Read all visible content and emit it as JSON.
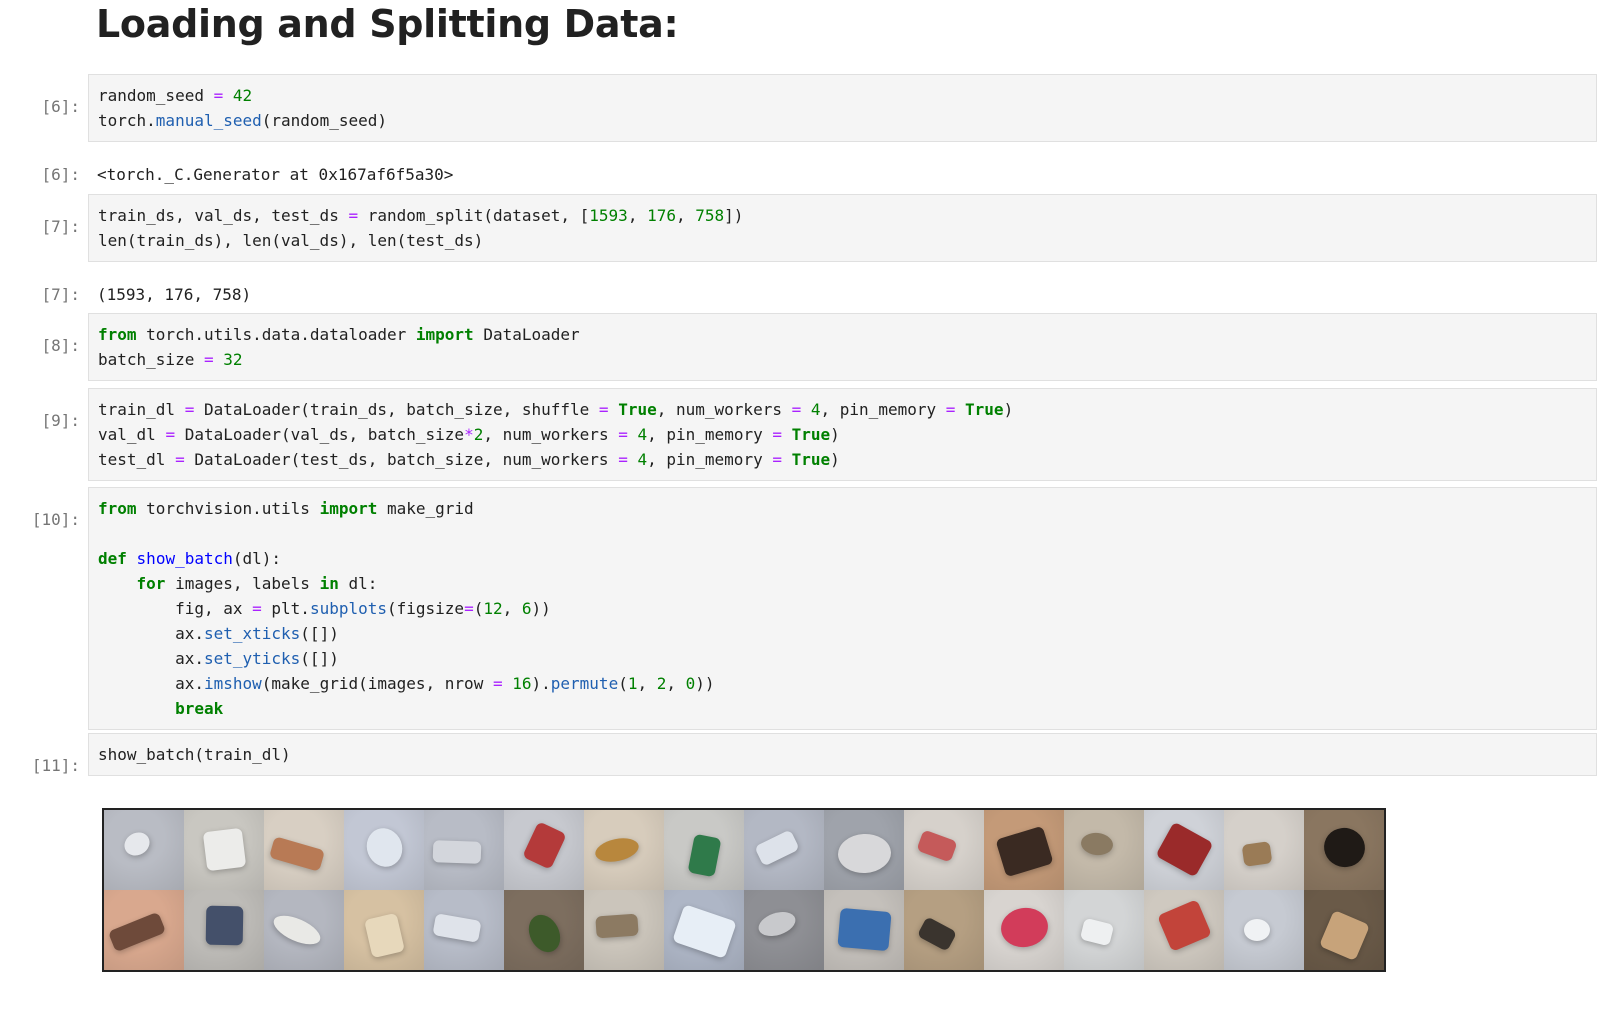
{
  "heading": "Loading and Splitting Data:",
  "cells": [
    {
      "in_prompt": "[6]:",
      "out_prompt": "[6]:",
      "output": "<torch._C.Generator at 0x167af6f5a30>"
    },
    {
      "in_prompt": "[7]:",
      "out_prompt": "[7]:",
      "output": "(1593, 176, 758)"
    },
    {
      "in_prompt": "[8]:"
    },
    {
      "in_prompt": "[9]:"
    },
    {
      "in_prompt": "[10]:"
    },
    {
      "in_prompt": "[11]:"
    }
  ],
  "code": {
    "c6": [
      "random_seed = 42",
      "torch.manual_seed(random_seed)"
    ],
    "c7": [
      "train_ds, val_ds, test_ds = random_split(dataset, [1593, 176, 758])",
      "len(train_ds), len(val_ds), len(test_ds)"
    ],
    "c8": [
      "from torch.utils.data.dataloader import DataLoader",
      "batch_size = 32"
    ],
    "c9": [
      "train_dl = DataLoader(train_ds, batch_size, shuffle = True, num_workers = 4, pin_memory = True)",
      "val_dl = DataLoader(val_ds, batch_size*2, num_workers = 4, pin_memory = True)",
      "test_dl = DataLoader(test_ds, batch_size, num_workers = 4, pin_memory = True)"
    ],
    "c10": [
      "from torchvision.utils import make_grid",
      "",
      "def show_batch(dl):",
      "    for images, labels in dl:",
      "        fig, ax = plt.subplots(figsize=(12, 6))",
      "        ax.set_xticks([])",
      "        ax.set_yticks([])",
      "        ax.imshow(make_grid(images, nrow = 16).permute(1, 2, 0))",
      "        break"
    ],
    "c11": [
      "show_batch(train_dl)"
    ]
  },
  "image_grid": {
    "description_tiles": [
      {
        "bg": "#b9bcc4",
        "obj": "#e6e8ec"
      },
      {
        "bg": "#c9c7c1",
        "obj": "#ececea"
      },
      {
        "bg": "#d8cfc3",
        "obj": "#b87a55"
      },
      {
        "bg": "#c2c7d4",
        "obj": "#e0e6ee"
      },
      {
        "bg": "#b8bcc6",
        "obj": "#d3d6dc"
      },
      {
        "bg": "#c7c9cf",
        "obj": "#b43a3a"
      },
      {
        "bg": "#d7ccbc",
        "obj": "#b8873d"
      },
      {
        "bg": "#c9c9c6",
        "obj": "#2f7a4a"
      },
      {
        "bg": "#b3b8c4",
        "obj": "#dde2ea"
      },
      {
        "bg": "#9fa3ab",
        "obj": "#d8d8da"
      },
      {
        "bg": "#d6d1cb",
        "obj": "#c55a5a"
      },
      {
        "bg": "#c49a78",
        "obj": "#3a2a22"
      },
      {
        "bg": "#c3b9a9",
        "obj": "#8a7a62"
      },
      {
        "bg": "#cfd2d8",
        "obj": "#9a2a2a"
      },
      {
        "bg": "#d5d0ca",
        "obj": "#9a7b56"
      },
      {
        "bg": "#8a7660",
        "obj": "#1f1a16"
      },
      {
        "bg": "#d9a88e",
        "obj": "#6e4a3a"
      },
      {
        "bg": "#bebcb8",
        "obj": "#44506a"
      },
      {
        "bg": "#b4b7c0",
        "obj": "#e9e9e6"
      },
      {
        "bg": "#d6c1a2",
        "obj": "#e7d8bb"
      },
      {
        "bg": "#b7bcc8",
        "obj": "#dfe3ea"
      },
      {
        "bg": "#7d6e5f",
        "obj": "#3d5a2a"
      },
      {
        "bg": "#cbc5bb",
        "obj": "#8c7a62"
      },
      {
        "bg": "#aeb6c6",
        "obj": "#e7eef6"
      },
      {
        "bg": "#8e8f94",
        "obj": "#c8c9cc"
      },
      {
        "bg": "#c4c0bb",
        "obj": "#3b6fb0"
      },
      {
        "bg": "#b59f82",
        "obj": "#3a342e"
      },
      {
        "bg": "#d8d4d0",
        "obj": "#d23c5a"
      },
      {
        "bg": "#d3d5d6",
        "obj": "#eef0f1"
      },
      {
        "bg": "#cfc9c0",
        "obj": "#c2443a"
      },
      {
        "bg": "#c6cad2",
        "obj": "#f0f2f4"
      },
      {
        "bg": "#6a5a48",
        "obj": "#c7a37a"
      }
    ]
  }
}
